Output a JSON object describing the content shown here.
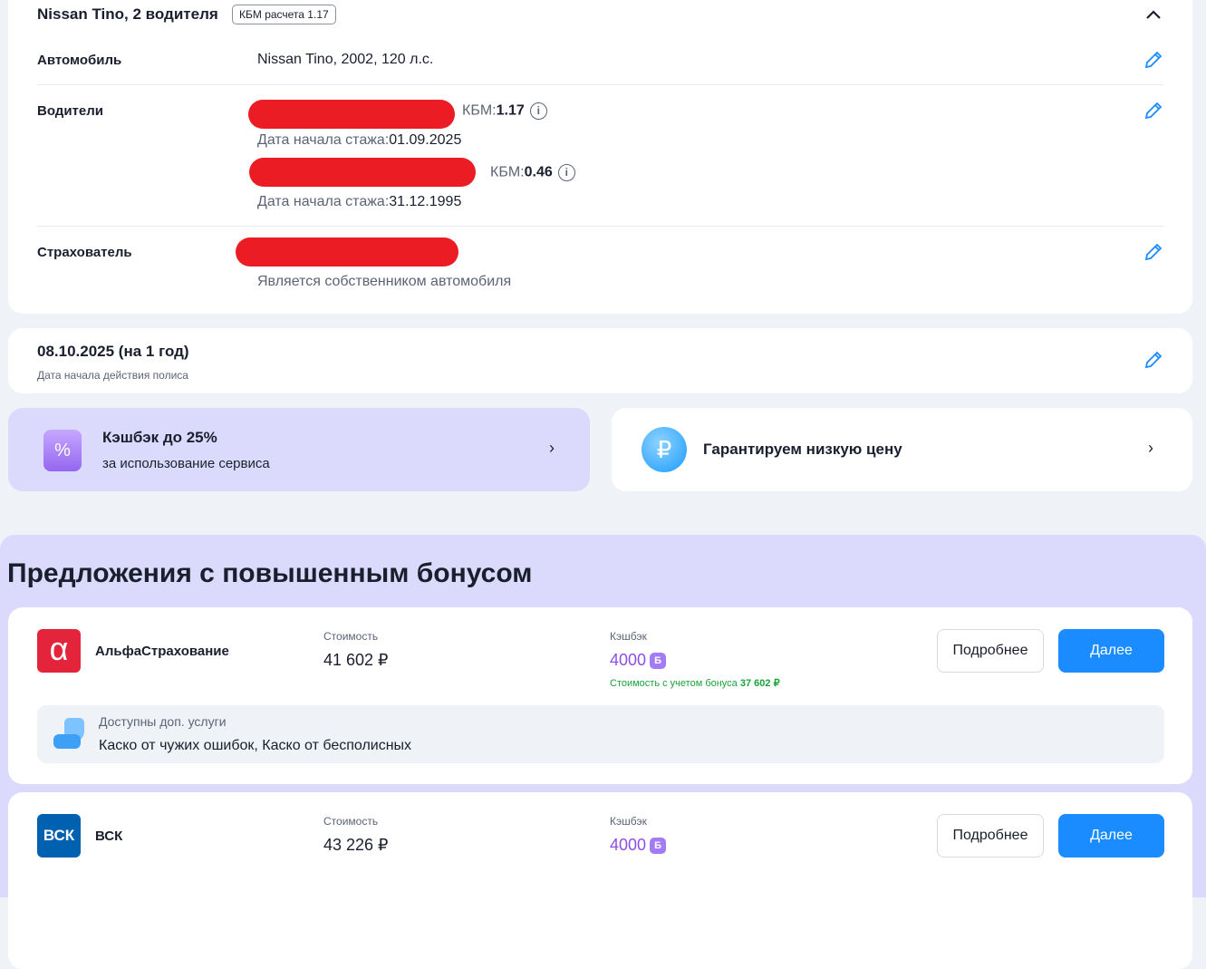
{
  "policy": {
    "title": "Nissan Tino, 2 водителя",
    "kbm_badge": "КБМ расчета 1.17",
    "car_label": "Автомобиль",
    "car_value": "Nissan Tino, 2002, 120 л.с.",
    "drivers_label": "Водители",
    "drivers": [
      {
        "kbm_label": "КБМ:",
        "kbm": "1.17",
        "exp_label": "Дата начала стажа:",
        "exp_date": "01.09.2025"
      },
      {
        "kbm_label": "КБМ:",
        "kbm": "0.46",
        "exp_label": "Дата начала стажа:",
        "exp_date": "31.12.1995"
      }
    ],
    "insurer_label": "Страхователь",
    "insurer_note": "Является собственником автомобиля"
  },
  "start": {
    "date": "08.10.2025 (на 1 год)",
    "label": "Дата начала действия полиса"
  },
  "promos": [
    {
      "title": "Кэшбэк до 25%",
      "subtitle": "за использование сервиса"
    },
    {
      "title": "Гарантируем низкую цену"
    }
  ],
  "offers_title": "Предложения с повышенным бонусом",
  "offers": [
    {
      "logo": "α",
      "name": "АльфаСтрахование",
      "cost_label": "Стоимость",
      "cost": "41 602 ₽",
      "cashback_label": "Кэшбэк",
      "cashback": "4000",
      "bonus_icon": "Б",
      "bonus_text": "Стоимость с учетом бонуса",
      "bonus_price": "37 602 ₽",
      "services_label": "Доступны доп. услуги",
      "services": "Каско от чужих ошибок, Каско от бесполисных",
      "more": "Подробнее",
      "next": "Далее"
    },
    {
      "logo": "ВСК",
      "name": "ВСК",
      "cost_label": "Стоимость",
      "cost": "43 226 ₽",
      "cashback_label": "Кэшбэк",
      "cashback": "4000",
      "bonus_icon": "Б",
      "more": "Подробнее",
      "next": "Далее"
    }
  ],
  "colors": {
    "accent": "#1a8cff",
    "purple": "#a27bf5",
    "green": "#1aa33a",
    "alfa": "#e3243b",
    "vsk": "#0061b0"
  }
}
